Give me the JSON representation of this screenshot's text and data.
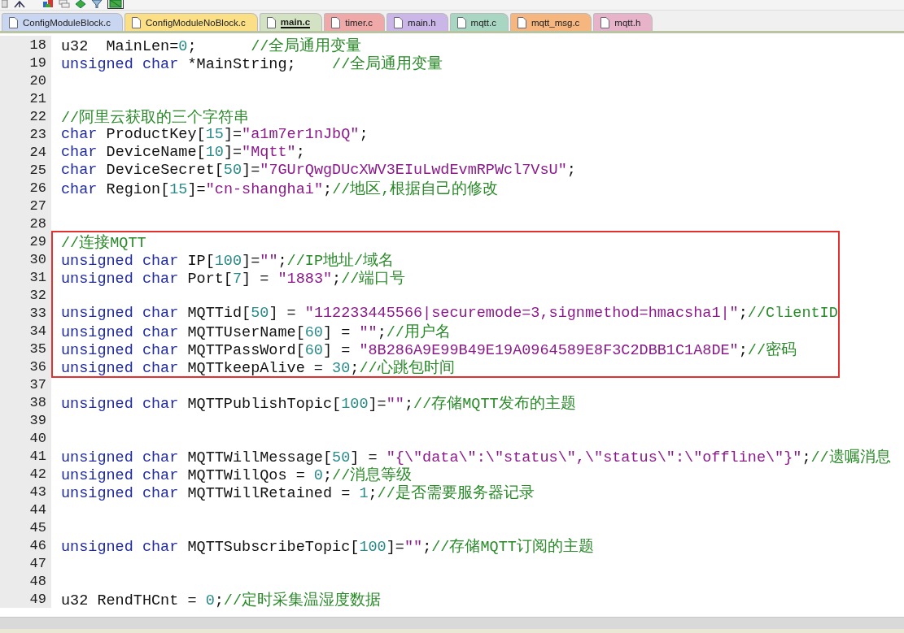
{
  "tabs": [
    {
      "label": "ConfigModuleBlock.c",
      "color": "#c9d6f2",
      "selected": false
    },
    {
      "label": "ConfigModuleNoBlock.c",
      "color": "#fbdf86",
      "selected": false
    },
    {
      "label": "main.c",
      "color": "#d3e2c3",
      "selected": true
    },
    {
      "label": "timer.c",
      "color": "#f0a9a9",
      "selected": false
    },
    {
      "label": "main.h",
      "color": "#cbb6e8",
      "selected": false
    },
    {
      "label": "mqtt.c",
      "color": "#a9d5c3",
      "selected": false
    },
    {
      "label": "mqtt_msg.c",
      "color": "#f6b67f",
      "selected": false
    },
    {
      "label": "mqtt.h",
      "color": "#e6b3c9",
      "selected": false
    }
  ],
  "sections": [
    {
      "boxed": false,
      "lines": [
        {
          "number": "18",
          "tokens": [
            {
              "kind": "plain",
              "text": "u32  MainLen="
            },
            {
              "kind": "number",
              "text": "0"
            },
            {
              "kind": "plain",
              "text": ";      "
            },
            {
              "kind": "comment",
              "text": "//全局通用变量"
            }
          ]
        },
        {
          "number": "19",
          "tokens": [
            {
              "kind": "keyword",
              "text": "unsigned char"
            },
            {
              "kind": "plain",
              "text": " *MainString;    "
            },
            {
              "kind": "comment",
              "text": "//全局通用变量"
            }
          ]
        },
        {
          "number": "20"
        },
        {
          "number": "21"
        },
        {
          "number": "22",
          "tokens": [
            {
              "kind": "comment",
              "text": "//阿里云获取的三个字符串"
            }
          ]
        },
        {
          "number": "23",
          "tokens": [
            {
              "kind": "keyword",
              "text": "char"
            },
            {
              "kind": "plain",
              "text": " ProductKey["
            },
            {
              "kind": "number",
              "text": "15"
            },
            {
              "kind": "plain",
              "text": "]="
            },
            {
              "kind": "string",
              "text": "\"a1m7er1nJbQ\""
            },
            {
              "kind": "plain",
              "text": ";"
            }
          ]
        },
        {
          "number": "24",
          "tokens": [
            {
              "kind": "keyword",
              "text": "char"
            },
            {
              "kind": "plain",
              "text": " DeviceName["
            },
            {
              "kind": "number",
              "text": "10"
            },
            {
              "kind": "plain",
              "text": "]="
            },
            {
              "kind": "string",
              "text": "\"Mqtt\""
            },
            {
              "kind": "plain",
              "text": ";"
            }
          ]
        },
        {
          "number": "25",
          "tokens": [
            {
              "kind": "keyword",
              "text": "char"
            },
            {
              "kind": "plain",
              "text": " DeviceSecret["
            },
            {
              "kind": "number",
              "text": "50"
            },
            {
              "kind": "plain",
              "text": "]="
            },
            {
              "kind": "string",
              "text": "\"7GUrQwgDUcXWV3EIuLwdEvmRPWcl7VsU\""
            },
            {
              "kind": "plain",
              "text": ";"
            }
          ]
        },
        {
          "number": "26",
          "tokens": [
            {
              "kind": "keyword",
              "text": "char"
            },
            {
              "kind": "plain",
              "text": " Region["
            },
            {
              "kind": "number",
              "text": "15"
            },
            {
              "kind": "plain",
              "text": "]="
            },
            {
              "kind": "string",
              "text": "\"cn-shanghai\""
            },
            {
              "kind": "plain",
              "text": ";"
            },
            {
              "kind": "comment",
              "text": "//地区,根据自己的修改"
            }
          ]
        },
        {
          "number": "27"
        },
        {
          "number": "28"
        }
      ]
    },
    {
      "boxed": true,
      "lines": [
        {
          "number": "29",
          "tokens": [
            {
              "kind": "comment",
              "text": "//连接MQTT"
            }
          ]
        },
        {
          "number": "30",
          "tokens": [
            {
              "kind": "keyword",
              "text": "unsigned char"
            },
            {
              "kind": "plain",
              "text": " IP["
            },
            {
              "kind": "number",
              "text": "100"
            },
            {
              "kind": "plain",
              "text": "]="
            },
            {
              "kind": "string",
              "text": "\"\""
            },
            {
              "kind": "plain",
              "text": ";"
            },
            {
              "kind": "comment",
              "text": "//IP地址/域名"
            }
          ]
        },
        {
          "number": "31",
          "tokens": [
            {
              "kind": "keyword",
              "text": "unsigned char"
            },
            {
              "kind": "plain",
              "text": " Port["
            },
            {
              "kind": "number",
              "text": "7"
            },
            {
              "kind": "plain",
              "text": "] = "
            },
            {
              "kind": "string",
              "text": "\"1883\""
            },
            {
              "kind": "plain",
              "text": ";"
            },
            {
              "kind": "comment",
              "text": "//端口号"
            }
          ]
        },
        {
          "number": "32"
        },
        {
          "number": "33",
          "tokens": [
            {
              "kind": "keyword",
              "text": "unsigned char"
            },
            {
              "kind": "plain",
              "text": " MQTTid["
            },
            {
              "kind": "number",
              "text": "50"
            },
            {
              "kind": "plain",
              "text": "] = "
            },
            {
              "kind": "string",
              "text": "\"112233445566|securemode=3,signmethod=hmacsha1|\""
            },
            {
              "kind": "plain",
              "text": ";"
            },
            {
              "kind": "comment",
              "text": "//ClientID"
            }
          ]
        },
        {
          "number": "34",
          "tokens": [
            {
              "kind": "keyword",
              "text": "unsigned char"
            },
            {
              "kind": "plain",
              "text": " MQTTUserName["
            },
            {
              "kind": "number",
              "text": "60"
            },
            {
              "kind": "plain",
              "text": "] = "
            },
            {
              "kind": "string",
              "text": "\"\""
            },
            {
              "kind": "plain",
              "text": ";"
            },
            {
              "kind": "comment",
              "text": "//用户名"
            }
          ]
        },
        {
          "number": "35",
          "tokens": [
            {
              "kind": "keyword",
              "text": "unsigned char"
            },
            {
              "kind": "plain",
              "text": " MQTTPassWord["
            },
            {
              "kind": "number",
              "text": "60"
            },
            {
              "kind": "plain",
              "text": "] = "
            },
            {
              "kind": "string",
              "text": "\"8B286A9E99B49E19A0964589E8F3C2DBB1C1A8DE\""
            },
            {
              "kind": "plain",
              "text": ";"
            },
            {
              "kind": "comment",
              "text": "//密码"
            }
          ]
        },
        {
          "number": "36",
          "tokens": [
            {
              "kind": "keyword",
              "text": "unsigned char"
            },
            {
              "kind": "plain",
              "text": " MQTTkeepAlive = "
            },
            {
              "kind": "number",
              "text": "30"
            },
            {
              "kind": "plain",
              "text": ";"
            },
            {
              "kind": "comment",
              "text": "//心跳包时间"
            }
          ]
        }
      ]
    },
    {
      "boxed": false,
      "lines": [
        {
          "number": "37"
        },
        {
          "number": "38",
          "tokens": [
            {
              "kind": "keyword",
              "text": "unsigned char"
            },
            {
              "kind": "plain",
              "text": " MQTTPublishTopic["
            },
            {
              "kind": "number",
              "text": "100"
            },
            {
              "kind": "plain",
              "text": "]="
            },
            {
              "kind": "string",
              "text": "\"\""
            },
            {
              "kind": "plain",
              "text": ";"
            },
            {
              "kind": "comment",
              "text": "//存储MQTT发布的主题"
            }
          ]
        },
        {
          "number": "39"
        },
        {
          "number": "40"
        },
        {
          "number": "41",
          "tokens": [
            {
              "kind": "keyword",
              "text": "unsigned char"
            },
            {
              "kind": "plain",
              "text": " MQTTWillMessage["
            },
            {
              "kind": "number",
              "text": "50"
            },
            {
              "kind": "plain",
              "text": "] = "
            },
            {
              "kind": "string",
              "text": "\"{\\\"data\\\":\\\"status\\\",\\\"status\\\":\\\"offline\\\"}\""
            },
            {
              "kind": "plain",
              "text": ";"
            },
            {
              "kind": "comment",
              "text": "//遗嘱消息"
            }
          ]
        },
        {
          "number": "42",
          "tokens": [
            {
              "kind": "keyword",
              "text": "unsigned char"
            },
            {
              "kind": "plain",
              "text": " MQTTWillQos = "
            },
            {
              "kind": "number",
              "text": "0"
            },
            {
              "kind": "plain",
              "text": ";"
            },
            {
              "kind": "comment",
              "text": "//消息等级"
            }
          ]
        },
        {
          "number": "43",
          "tokens": [
            {
              "kind": "keyword",
              "text": "unsigned char"
            },
            {
              "kind": "plain",
              "text": " MQTTWillRetained = "
            },
            {
              "kind": "number",
              "text": "1"
            },
            {
              "kind": "plain",
              "text": ";"
            },
            {
              "kind": "comment",
              "text": "//是否需要服务器记录"
            }
          ]
        },
        {
          "number": "44"
        },
        {
          "number": "45"
        },
        {
          "number": "46",
          "tokens": [
            {
              "kind": "keyword",
              "text": "unsigned char"
            },
            {
              "kind": "plain",
              "text": " MQTTSubscribeTopic["
            },
            {
              "kind": "number",
              "text": "100"
            },
            {
              "kind": "plain",
              "text": "]="
            },
            {
              "kind": "string",
              "text": "\"\""
            },
            {
              "kind": "plain",
              "text": ";"
            },
            {
              "kind": "comment",
              "text": "//存储MQTT订阅的主题"
            }
          ]
        },
        {
          "number": "47"
        },
        {
          "number": "48"
        },
        {
          "number": "49",
          "tokens": [
            {
              "kind": "plain",
              "text": "u32 RendTHCnt = "
            },
            {
              "kind": "number",
              "text": "0"
            },
            {
              "kind": "plain",
              "text": ";"
            },
            {
              "kind": "comment",
              "text": "//定时采集温湿度数据"
            }
          ]
        }
      ]
    }
  ]
}
